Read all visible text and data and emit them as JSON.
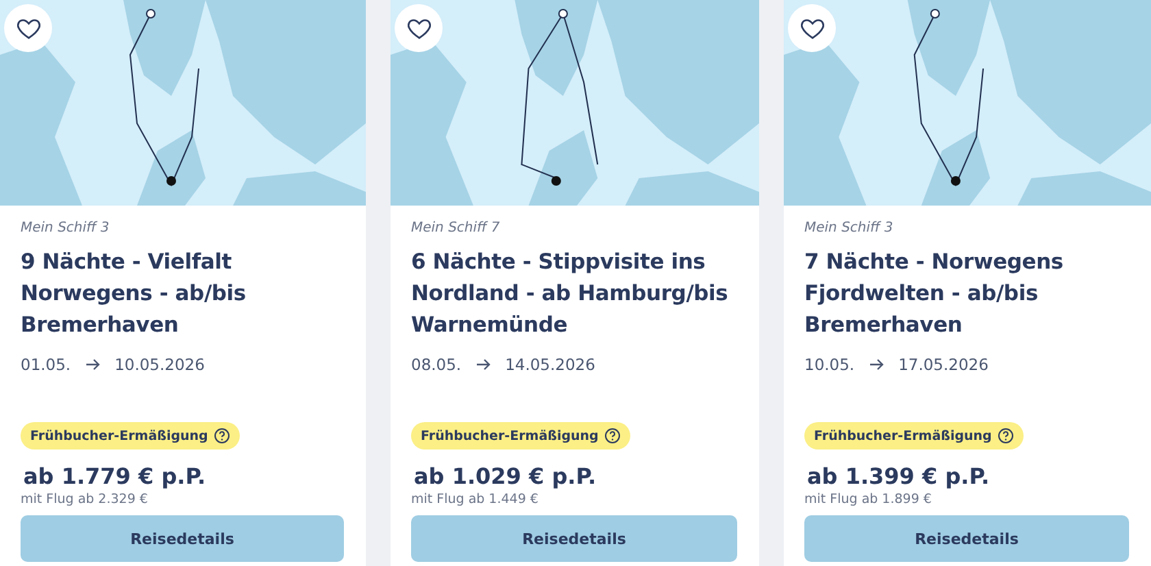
{
  "cruises": [
    {
      "favorite": false,
      "ship": "Mein Schiff 3",
      "title": "9 Nächte - Vielfalt Norwegens - ab/bis Bremerhaven",
      "date_from": "01.05.",
      "date_to": "10.05.2026",
      "badge": "Frühbucher-Ermäßigung",
      "price": "ab 1.779 € p.P.",
      "flight_price": "mit Flug ab 2.329 €",
      "button": "Reisedetails"
    },
    {
      "favorite": false,
      "ship": "Mein Schiff 7",
      "title": "6 Nächte - Stippvisite ins Nordland - ab Hamburg/bis Warnemünde",
      "date_from": "08.05.",
      "date_to": "14.05.2026",
      "badge": "Frühbucher-Ermäßigung",
      "price": "ab 1.029 € p.P.",
      "flight_price": "mit Flug ab 1.449 €",
      "button": "Reisedetails"
    },
    {
      "favorite": false,
      "ship": "Mein Schiff 3",
      "title": "7 Nächte - Norwegens Fjordwelten - ab/bis Bremerhaven",
      "date_from": "10.05.",
      "date_to": "17.05.2026",
      "badge": "Frühbucher-Ermäßigung",
      "price": "ab 1.399 € p.P.",
      "flight_price": "mit Flug ab 1.899 €",
      "button": "Reisedetails"
    }
  ]
}
